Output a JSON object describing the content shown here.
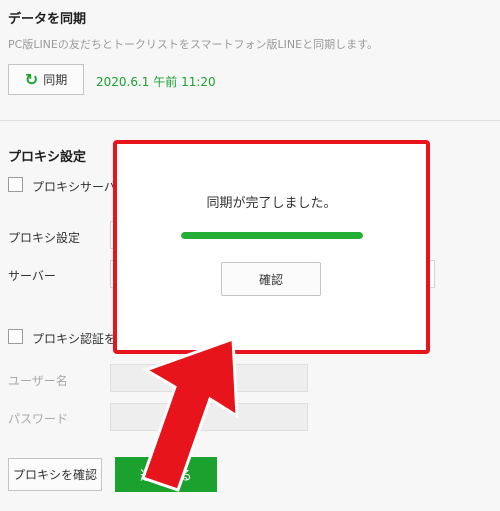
{
  "sync": {
    "title": "データを同期",
    "description": "PC版LINEの友だちとトークリストをスマートフォン版LINEと同期します。",
    "button_label": "同期",
    "last_synced": "2020.6.1 午前 11:20"
  },
  "proxy": {
    "title": "プロキシ設定",
    "use_proxy_label": "プロキシサーバー",
    "proxy_setting_label": "プロキシ設定",
    "server_label": "サーバー",
    "auth_label": "プロキシ認証を",
    "username_label": "ユーザー名",
    "password_label": "パスワード",
    "check_button": "プロキシを確認",
    "apply_button": "適用する"
  },
  "dialog": {
    "message": "同期が完了しました。",
    "progress_fraction": 1.0,
    "ok_button": "確認"
  },
  "icons": {
    "sync": "refresh-icon",
    "annotation": "red-arrow-icon"
  },
  "colors": {
    "accent_green": "#1aa12e",
    "annotation_red": "#e8141c"
  }
}
